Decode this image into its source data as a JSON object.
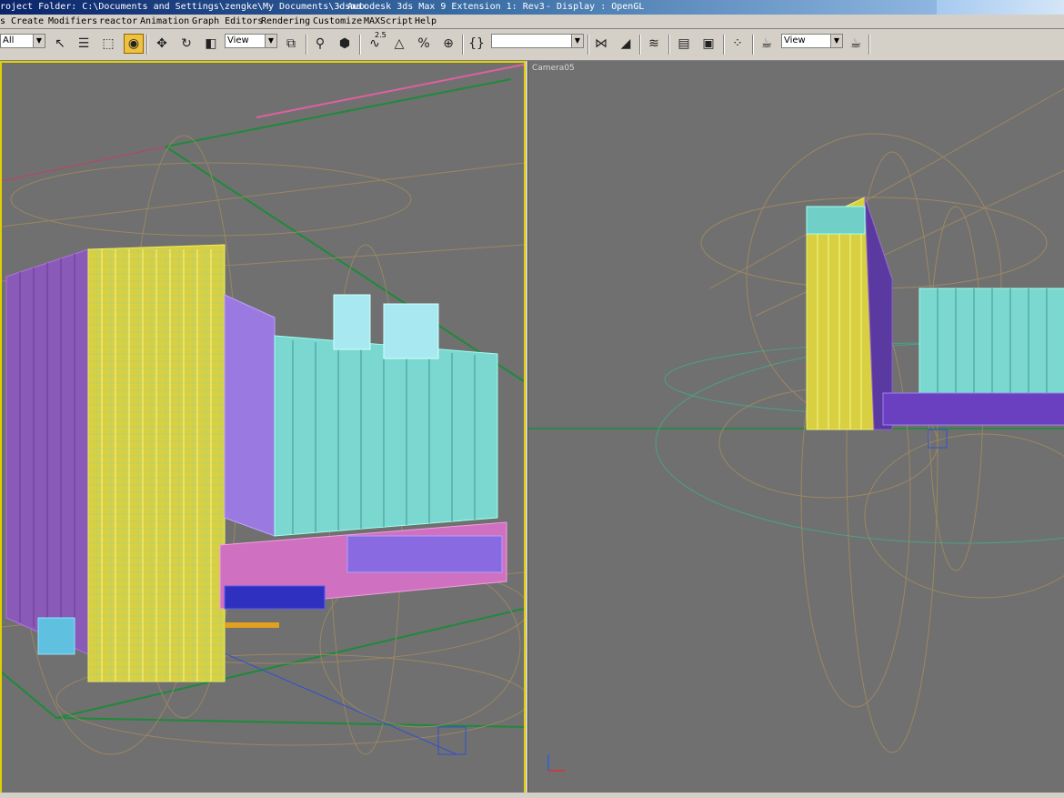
{
  "window": {
    "title_path": "roject Folder: C:\\Documents and Settings\\zengke\\My Documents\\3dsmax",
    "title_app": "- Autodesk 3ds Max 9 Extension 1: Rev3",
    "title_display": "- Display : OpenGL"
  },
  "menu": [
    "s",
    "Create",
    "Modifiers",
    "reactor",
    "Animation",
    "Graph Editors",
    "Rendering",
    "Customize",
    "MAXScript",
    "Help"
  ],
  "toolbar": {
    "selection_filter": "All",
    "ref_coord_1": "View",
    "named_selection": "",
    "ref_coord_2": "View",
    "snap_angle_label": "2.5",
    "icons": [
      "select-arrow",
      "select-by-name",
      "rect-region",
      "window-crossing",
      "move",
      "rotate",
      "scale",
      "pivot",
      "mirror-link",
      "select-manipulate",
      "snap-2d",
      "angle-snap",
      "percent-snap",
      "spinner-snap",
      "edit-named-sets",
      "mirror",
      "align",
      "layer-manager",
      "curve-editor",
      "schematic-view",
      "material-editor",
      "render-scene",
      "quick-render"
    ]
  },
  "viewports": {
    "left": {
      "label": "",
      "active": true
    },
    "right": {
      "label": "Camera05",
      "active": false
    }
  },
  "colors": {
    "viewport_bg": "#707070",
    "active_border": "#e0d000",
    "ui_gray": "#d4d0c8"
  }
}
